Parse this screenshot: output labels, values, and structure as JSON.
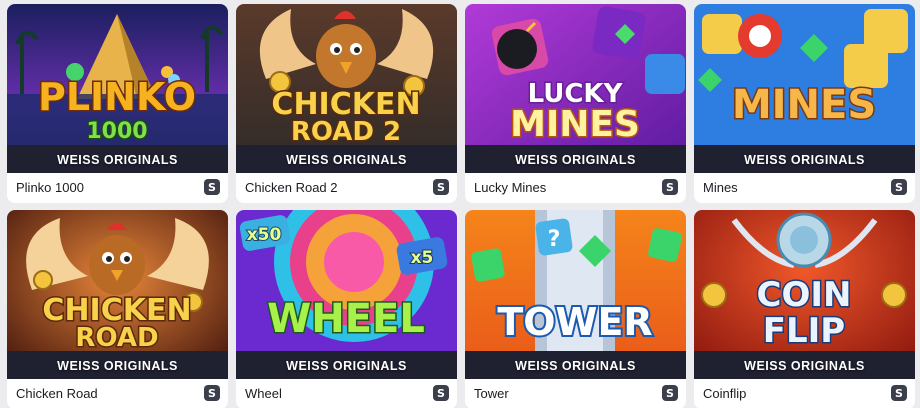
{
  "brand_label": "WEISS ORIGINALS",
  "provider_icon": "S",
  "games": [
    {
      "name": "Plinko 1000",
      "logo": [
        "PLINKO",
        "1000"
      ],
      "theme": "plinko"
    },
    {
      "name": "Chicken Road 2",
      "logo": [
        "CHICKEN",
        "ROAD 2"
      ],
      "theme": "chicken2"
    },
    {
      "name": "Lucky Mines",
      "logo": [
        "LUCKY",
        "MINES"
      ],
      "theme": "luckymines"
    },
    {
      "name": "Mines",
      "logo": [
        "MINES"
      ],
      "theme": "mines"
    },
    {
      "name": "Chicken Road",
      "logo": [
        "CHICKEN",
        "ROAD"
      ],
      "theme": "chicken"
    },
    {
      "name": "Wheel",
      "logo": [
        "WHEEL"
      ],
      "badges": [
        "x50",
        "x5"
      ],
      "theme": "wheel"
    },
    {
      "name": "Tower",
      "logo": [
        "TOWER"
      ],
      "theme": "tower"
    },
    {
      "name": "Coinflip",
      "logo": [
        "COIN",
        "FLIP"
      ],
      "theme": "coinflip"
    }
  ],
  "colors": {
    "page_bg": "#ececef",
    "card_bg": "#ffffff",
    "brand_strip": "#1f2030",
    "provider_badge": "#3a3f4b"
  }
}
